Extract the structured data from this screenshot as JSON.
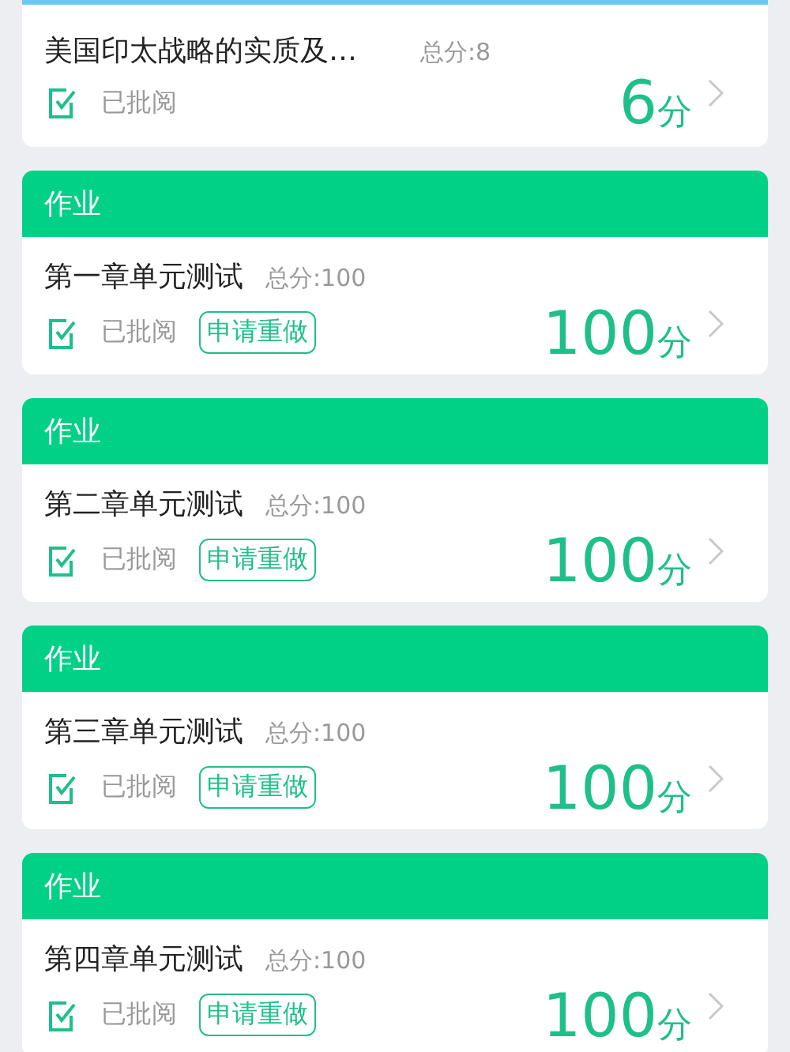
{
  "cards": [
    {
      "color": "#6ec8f2",
      "title": "美国印太战略的实质及…",
      "total": "总分:8",
      "status": "已批阅",
      "score": "6",
      "unit": "分"
    },
    {
      "color": "#00d186",
      "header": "作业",
      "title": "第一章单元测试",
      "total": "总分:100",
      "status": "已批阅",
      "redo_button": "申请重做",
      "score": "100",
      "unit": "分"
    },
    {
      "color": "#00d186",
      "header": "作业",
      "title": "第二章单元测试",
      "total": "总分:100",
      "status": "已批阅",
      "redo_button": "申请重做",
      "score": "100",
      "unit": "分"
    },
    {
      "color": "#00d186",
      "header": "作业",
      "title": "第三章单元测试",
      "total": "总分:100",
      "status": "已批阅",
      "redo_button": "申请重做",
      "score": "100",
      "unit": "分"
    },
    {
      "color": "#00d186",
      "header": "作业",
      "title": "第四章单元测试",
      "total": "总分:100",
      "status": "已批阅",
      "redo_button": "申请重做",
      "score": "100",
      "unit": "分"
    }
  ]
}
